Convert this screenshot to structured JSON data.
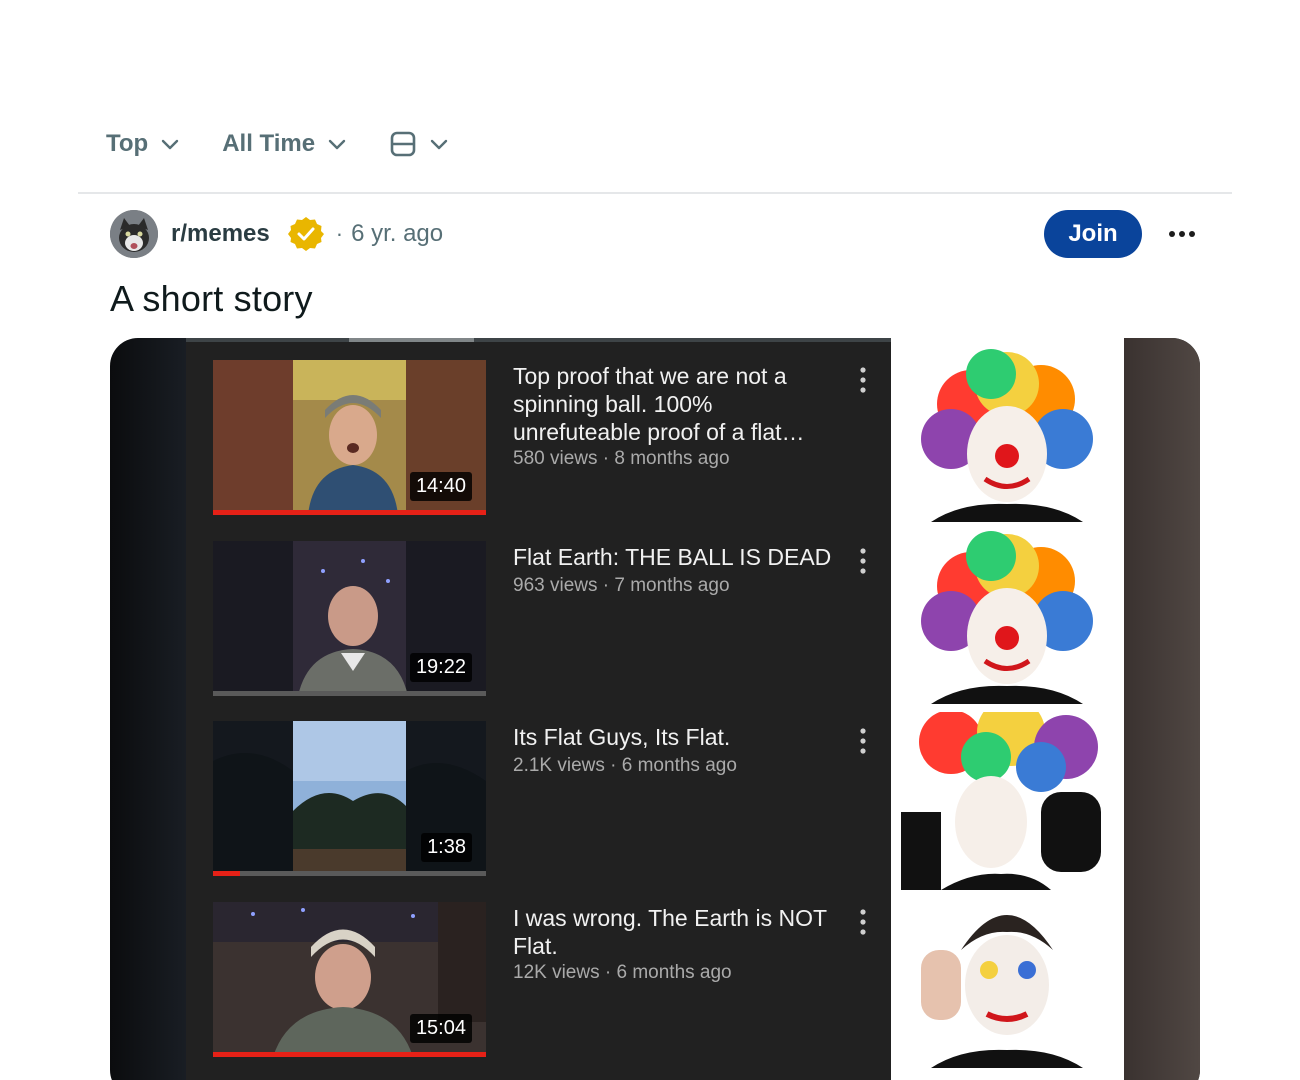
{
  "sort": {
    "sort_label": "Top",
    "time_label": "All Time",
    "view_icon": "layout-card-icon"
  },
  "post": {
    "subreddit": "r/memes",
    "age": "6 yr. ago",
    "separator": "·",
    "join_label": "Join",
    "title": "A short story"
  },
  "videos": [
    {
      "title": "Top proof that we are not a spinning ball. 100% unrefuteable proof of a flat…",
      "meta": "580 views · 8 months ago",
      "duration": "14:40",
      "progress": 1.0
    },
    {
      "title": "Flat Earth: THE BALL IS DEAD",
      "meta": "963 views · 7 months ago",
      "duration": "19:22",
      "progress": 0.0
    },
    {
      "title": "Its Flat Guys, Its Flat.",
      "meta": "2.1K views · 6 months ago",
      "duration": "1:38",
      "progress": 0.1
    },
    {
      "title": "I was wrong. The Earth is NOT Flat.",
      "meta": "12K views · 6 months ago",
      "duration": "15:04",
      "progress": 1.0
    }
  ],
  "colors": {
    "join_bg": "#0a449b",
    "verified_badge": "#e9b600",
    "progress_red": "#e62117"
  }
}
